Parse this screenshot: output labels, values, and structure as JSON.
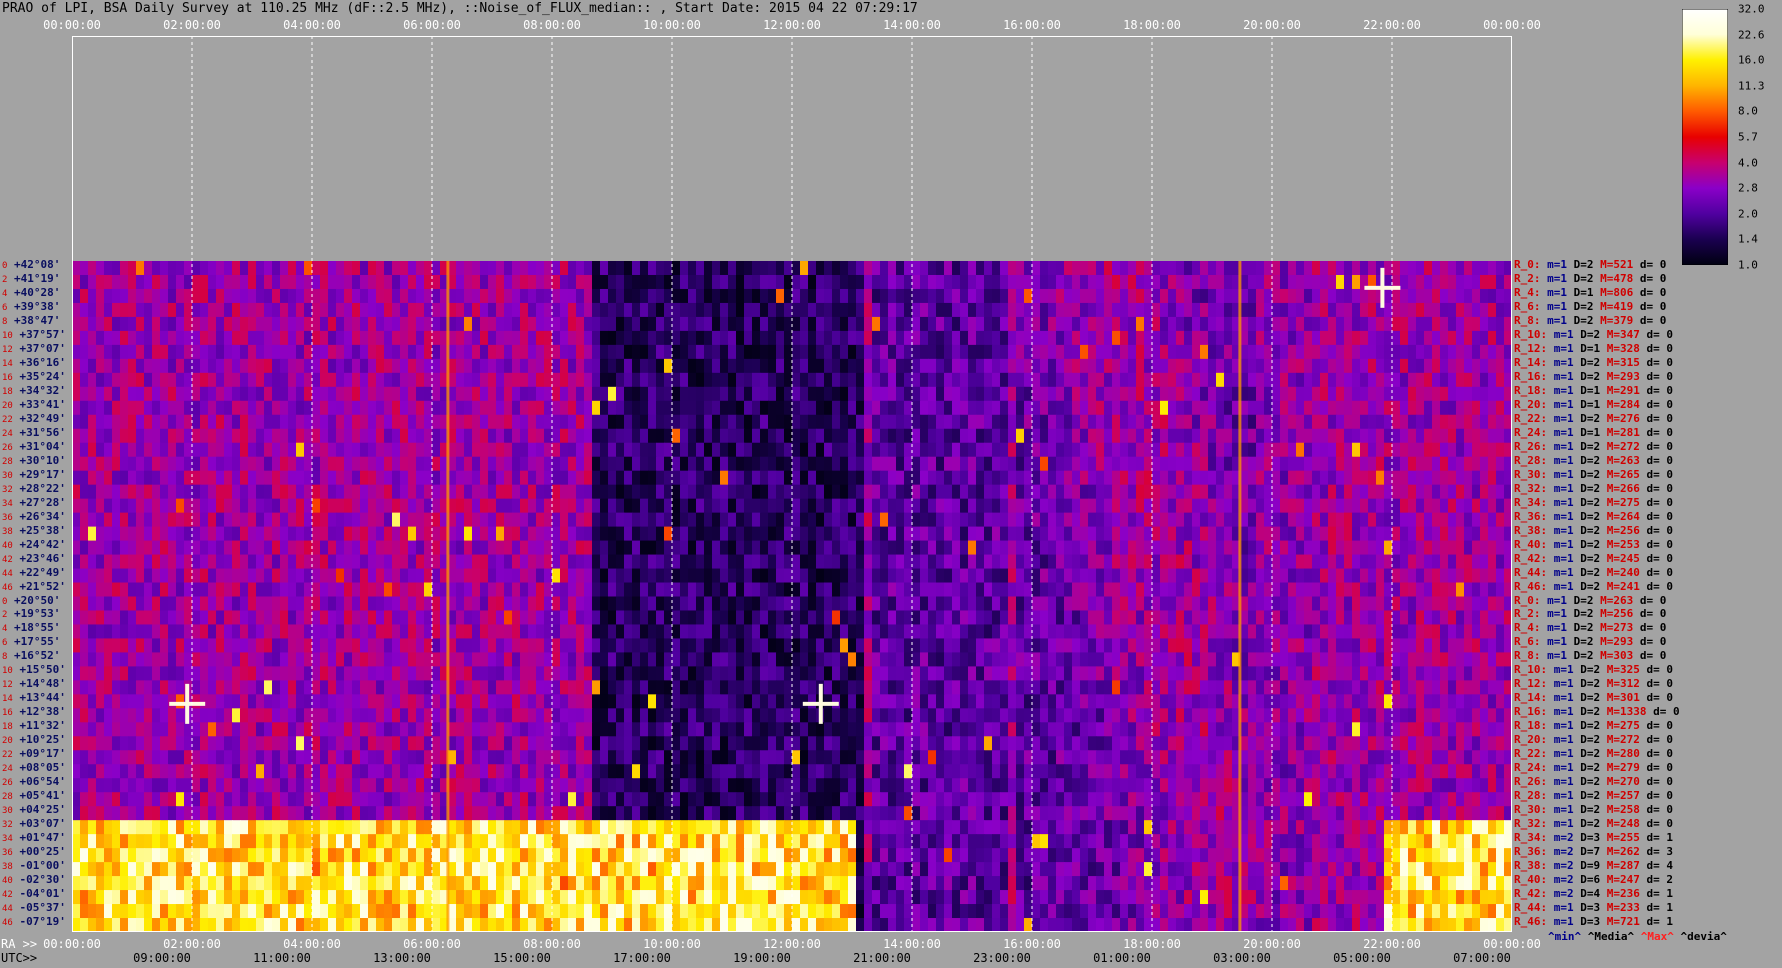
{
  "title": "PRAO of LPI, BSA Daily Survey at 110.25 MHz (dF::2.5 MHz), ::Noise_of_FLUX_median:: , Start Date: 2015 04 22 07:29:17",
  "chart_data": {
    "type": "heatmap",
    "title": "PRAO of LPI, BSA Daily Survey at 110.25 MHz (dF::2.5 MHz), ::Noise_of_FLUX_median:: , Start Date: 2015 04 22 07:29:17",
    "top_axis_ticks": [
      "00:00:00",
      "02:00:00",
      "04:00:00",
      "06:00:00",
      "08:00:00",
      "10:00:00",
      "12:00:00",
      "14:00:00",
      "16:00:00",
      "18:00:00",
      "20:00:00",
      "22:00:00",
      "00:00:00"
    ],
    "ra_prefix": "RA >>",
    "ra_ticks": [
      "00:00:00",
      "02:00:00",
      "04:00:00",
      "06:00:00",
      "08:00:00",
      "10:00:00",
      "12:00:00",
      "14:00:00",
      "16:00:00",
      "18:00:00",
      "20:00:00",
      "22:00:00",
      "00:00:00"
    ],
    "utc_prefix": "UTC>>",
    "utc_ticks": [
      "09:00:00",
      "11:00:00",
      "13:00:00",
      "15:00:00",
      "17:00:00",
      "19:00:00",
      "21:00:00",
      "23:00:00",
      "01:00:00",
      "03:00:00",
      "05:00:00",
      "07:00:00"
    ],
    "colorbar_ticks": [
      "32.0",
      "22.6",
      "16.0",
      "11.3",
      "8.0",
      "5.7",
      "4.0",
      "2.8",
      "2.0",
      "1.4",
      "1.0"
    ],
    "colorbar_range": [
      1.0,
      32.0
    ],
    "colorbar_scale": "log",
    "color_stops": [
      "#000010",
      "#1a0050",
      "#5000a0",
      "#8a00c8",
      "#c8006e",
      "#e80000",
      "#ff5a00",
      "#ffb400",
      "#fff000",
      "#ffffd8",
      "#ffffff"
    ],
    "rows": [
      {
        "idx": "0",
        "dec": "+42°08'"
      },
      {
        "idx": "2",
        "dec": "+41°19'"
      },
      {
        "idx": "4",
        "dec": "+40°28'"
      },
      {
        "idx": "6",
        "dec": "+39°38'"
      },
      {
        "idx": "8",
        "dec": "+38°47'"
      },
      {
        "idx": "10",
        "dec": "+37°57'"
      },
      {
        "idx": "12",
        "dec": "+37°07'"
      },
      {
        "idx": "14",
        "dec": "+36°16'"
      },
      {
        "idx": "16",
        "dec": "+35°24'"
      },
      {
        "idx": "18",
        "dec": "+34°32'"
      },
      {
        "idx": "20",
        "dec": "+33°41'"
      },
      {
        "idx": "22",
        "dec": "+32°49'"
      },
      {
        "idx": "24",
        "dec": "+31°56'"
      },
      {
        "idx": "26",
        "dec": "+31°04'"
      },
      {
        "idx": "28",
        "dec": "+30°10'"
      },
      {
        "idx": "30",
        "dec": "+29°17'"
      },
      {
        "idx": "32",
        "dec": "+28°22'"
      },
      {
        "idx": "34",
        "dec": "+27°28'"
      },
      {
        "idx": "36",
        "dec": "+26°34'"
      },
      {
        "idx": "38",
        "dec": "+25°38'"
      },
      {
        "idx": "40",
        "dec": "+24°42'"
      },
      {
        "idx": "42",
        "dec": "+23°46'"
      },
      {
        "idx": "44",
        "dec": "+22°49'"
      },
      {
        "idx": "46",
        "dec": "+21°52'"
      },
      {
        "idx": "0",
        "dec": "+20°50'"
      },
      {
        "idx": "2",
        "dec": "+19°53'"
      },
      {
        "idx": "4",
        "dec": "+18°55'"
      },
      {
        "idx": "6",
        "dec": "+17°55'"
      },
      {
        "idx": "8",
        "dec": "+16°52'"
      },
      {
        "idx": "10",
        "dec": "+15°50'"
      },
      {
        "idx": "12",
        "dec": "+14°48'"
      },
      {
        "idx": "14",
        "dec": "+13°44'"
      },
      {
        "idx": "16",
        "dec": "+12°38'"
      },
      {
        "idx": "18",
        "dec": "+11°32'"
      },
      {
        "idx": "20",
        "dec": "+10°25'"
      },
      {
        "idx": "22",
        "dec": "+09°17'"
      },
      {
        "idx": "24",
        "dec": "+08°05'"
      },
      {
        "idx": "26",
        "dec": "+06°54'"
      },
      {
        "idx": "28",
        "dec": "+05°41'"
      },
      {
        "idx": "30",
        "dec": "+04°25'"
      },
      {
        "idx": "32",
        "dec": "+03°07'"
      },
      {
        "idx": "34",
        "dec": "+01°47'"
      },
      {
        "idx": "36",
        "dec": "+00°25'"
      },
      {
        "idx": "38",
        "dec": "-01°00'"
      },
      {
        "idx": "40",
        "dec": "-02°30'"
      },
      {
        "idx": "42",
        "dec": "-04°01'"
      },
      {
        "idx": "44",
        "dec": "-05°37'"
      },
      {
        "idx": "46",
        "dec": "-07°19'"
      }
    ],
    "stats": [
      {
        "r": "R_0:",
        "min": "m=1",
        "med": "D=2",
        "max": "M=521",
        "dev": "d= 0"
      },
      {
        "r": "R_2:",
        "min": "m=1",
        "med": "D=2",
        "max": "M=478",
        "dev": "d= 0"
      },
      {
        "r": "R_4:",
        "min": "m=1",
        "med": "D=1",
        "max": "M=806",
        "dev": "d= 0"
      },
      {
        "r": "R_6:",
        "min": "m=1",
        "med": "D=2",
        "max": "M=419",
        "dev": "d= 0"
      },
      {
        "r": "R_8:",
        "min": "m=1",
        "med": "D=2",
        "max": "M=379",
        "dev": "d= 0"
      },
      {
        "r": "R_10:",
        "min": "m=1",
        "med": "D=2",
        "max": "M=347",
        "dev": "d= 0"
      },
      {
        "r": "R_12:",
        "min": "m=1",
        "med": "D=1",
        "max": "M=328",
        "dev": "d= 0"
      },
      {
        "r": "R_14:",
        "min": "m=1",
        "med": "D=2",
        "max": "M=315",
        "dev": "d= 0"
      },
      {
        "r": "R_16:",
        "min": "m=1",
        "med": "D=2",
        "max": "M=293",
        "dev": "d= 0"
      },
      {
        "r": "R_18:",
        "min": "m=1",
        "med": "D=1",
        "max": "M=291",
        "dev": "d= 0"
      },
      {
        "r": "R_20:",
        "min": "m=1",
        "med": "D=1",
        "max": "M=284",
        "dev": "d= 0"
      },
      {
        "r": "R_22:",
        "min": "m=1",
        "med": "D=2",
        "max": "M=276",
        "dev": "d= 0"
      },
      {
        "r": "R_24:",
        "min": "m=1",
        "med": "D=1",
        "max": "M=281",
        "dev": "d= 0"
      },
      {
        "r": "R_26:",
        "min": "m=1",
        "med": "D=2",
        "max": "M=272",
        "dev": "d= 0"
      },
      {
        "r": "R_28:",
        "min": "m=1",
        "med": "D=2",
        "max": "M=263",
        "dev": "d= 0"
      },
      {
        "r": "R_30:",
        "min": "m=1",
        "med": "D=2",
        "max": "M=265",
        "dev": "d= 0"
      },
      {
        "r": "R_32:",
        "min": "m=1",
        "med": "D=2",
        "max": "M=266",
        "dev": "d= 0"
      },
      {
        "r": "R_34:",
        "min": "m=1",
        "med": "D=2",
        "max": "M=275",
        "dev": "d= 0"
      },
      {
        "r": "R_36:",
        "min": "m=1",
        "med": "D=2",
        "max": "M=264",
        "dev": "d= 0"
      },
      {
        "r": "R_38:",
        "min": "m=1",
        "med": "D=2",
        "max": "M=256",
        "dev": "d= 0"
      },
      {
        "r": "R_40:",
        "min": "m=1",
        "med": "D=2",
        "max": "M=253",
        "dev": "d= 0"
      },
      {
        "r": "R_42:",
        "min": "m=1",
        "med": "D=2",
        "max": "M=245",
        "dev": "d= 0"
      },
      {
        "r": "R_44:",
        "min": "m=1",
        "med": "D=2",
        "max": "M=240",
        "dev": "d= 0"
      },
      {
        "r": "R_46:",
        "min": "m=1",
        "med": "D=2",
        "max": "M=241",
        "dev": "d= 0"
      },
      {
        "r": "R_0:",
        "min": "m=1",
        "med": "D=2",
        "max": "M=263",
        "dev": "d= 0"
      },
      {
        "r": "R_2:",
        "min": "m=1",
        "med": "D=2",
        "max": "M=256",
        "dev": "d= 0"
      },
      {
        "r": "R_4:",
        "min": "m=1",
        "med": "D=2",
        "max": "M=273",
        "dev": "d= 0"
      },
      {
        "r": "R_6:",
        "min": "m=1",
        "med": "D=2",
        "max": "M=293",
        "dev": "d= 0"
      },
      {
        "r": "R_8:",
        "min": "m=1",
        "med": "D=2",
        "max": "M=303",
        "dev": "d= 0"
      },
      {
        "r": "R_10:",
        "min": "m=1",
        "med": "D=2",
        "max": "M=325",
        "dev": "d= 0"
      },
      {
        "r": "R_12:",
        "min": "m=1",
        "med": "D=2",
        "max": "M=312",
        "dev": "d= 0"
      },
      {
        "r": "R_14:",
        "min": "m=1",
        "med": "D=2",
        "max": "M=301",
        "dev": "d= 0"
      },
      {
        "r": "R_16:",
        "min": "m=1",
        "med": "D=2",
        "max": "M=1338",
        "dev": "d= 0"
      },
      {
        "r": "R_18:",
        "min": "m=1",
        "med": "D=2",
        "max": "M=275",
        "dev": "d= 0"
      },
      {
        "r": "R_20:",
        "min": "m=1",
        "med": "D=2",
        "max": "M=272",
        "dev": "d= 0"
      },
      {
        "r": "R_22:",
        "min": "m=1",
        "med": "D=2",
        "max": "M=280",
        "dev": "d= 0"
      },
      {
        "r": "R_24:",
        "min": "m=1",
        "med": "D=2",
        "max": "M=279",
        "dev": "d= 0"
      },
      {
        "r": "R_26:",
        "min": "m=1",
        "med": "D=2",
        "max": "M=270",
        "dev": "d= 0"
      },
      {
        "r": "R_28:",
        "min": "m=1",
        "med": "D=2",
        "max": "M=257",
        "dev": "d= 0"
      },
      {
        "r": "R_30:",
        "min": "m=1",
        "med": "D=2",
        "max": "M=258",
        "dev": "d= 0"
      },
      {
        "r": "R_32:",
        "min": "m=1",
        "med": "D=2",
        "max": "M=248",
        "dev": "d= 0"
      },
      {
        "r": "R_34:",
        "min": "m=2",
        "med": "D=3",
        "max": "M=255",
        "dev": "d= 1"
      },
      {
        "r": "R_36:",
        "min": "m=2",
        "med": "D=7",
        "max": "M=262",
        "dev": "d= 3"
      },
      {
        "r": "R_38:",
        "min": "m=2",
        "med": "D=9",
        "max": "M=287",
        "dev": "d= 4"
      },
      {
        "r": "R_40:",
        "min": "m=2",
        "med": "D=6",
        "max": "M=247",
        "dev": "d= 2"
      },
      {
        "r": "R_42:",
        "min": "m=2",
        "med": "D=4",
        "max": "M=236",
        "dev": "d= 1"
      },
      {
        "r": "R_44:",
        "min": "m=1",
        "med": "D=3",
        "max": "M=233",
        "dev": "d= 1"
      },
      {
        "r": "R_46:",
        "min": "m=1",
        "med": "D=3",
        "max": "M=721",
        "dev": "d= 1"
      }
    ],
    "stat_legend": {
      "min": "^min^",
      "median": "^Media^",
      "max": "^Max^",
      "dev": "^devia^"
    }
  }
}
